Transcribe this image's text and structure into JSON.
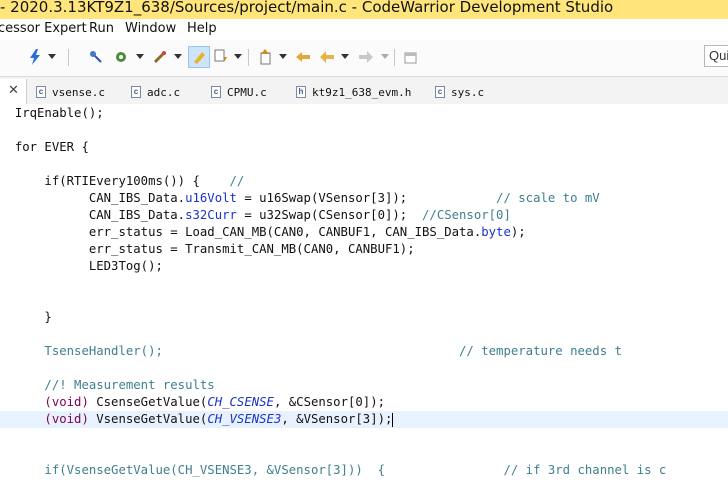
{
  "window": {
    "title": "- 2020.3.13KT9Z1_638/Sources/project/main.c - CodeWarrior Development Studio"
  },
  "menu": {
    "items": [
      "cessor Expert",
      "Run",
      "Window",
      "Help"
    ]
  },
  "toolbar": {
    "icons": [
      "lightning-icon",
      "bug-pin-icon",
      "gear-bug-icon",
      "wand-icon",
      "highlight-icon",
      "annotation-down-icon",
      "annotation-up-icon",
      "back-icon",
      "forward-icon",
      "new-window-icon"
    ],
    "search_placeholder": "Quic"
  },
  "tabs": [
    {
      "label": "vsense.c",
      "icon": "c"
    },
    {
      "label": "adc.c",
      "icon": "c"
    },
    {
      "label": "CPMU.c",
      "icon": "c"
    },
    {
      "label": "kt9z1_638_evm.h",
      "icon": "h"
    },
    {
      "label": "sys.c",
      "icon": "c"
    }
  ],
  "code": {
    "l1": "IrqEnable();",
    "l2": "for EVER {",
    "l3a": "if(RTIEvery100ms()) {",
    "l3b": "//",
    "l4a": "CAN_IBS_Data.",
    "l4b": "u16Volt",
    "l4c": " = u16Swap(VSensor[3]);",
    "l4d": "// scale to mV",
    "l5a": "CAN_IBS_Data.",
    "l5b": "s32Curr",
    "l5c": " = u32Swap(CSensor[0]);",
    "l5d": "//CSensor[0]",
    "l6a": "err_status = Load_CAN_MB(CAN0, CANBUF1, CAN_IBS_Data.",
    "l6b": "byte",
    "l6c": ");",
    "l7": "err_status = Transmit_CAN_MB(CAN0, CANBUF1);",
    "l8": "LED3Tog();",
    "l9": "}",
    "l10a": "TsenseHandler();",
    "l10b": "// temperature needs t",
    "l11": "//! Measurement results",
    "l12a": "(void)",
    "l12b": " CsenseGetValue(",
    "l12c": "CH_CSENSE",
    "l12d": ", &CSensor[0]);",
    "l13a": "(void)",
    "l13b": " VsenseGetValue(",
    "l13c": "CH_VSENSE3",
    "l13d": ", &VSensor[3]);",
    "l14a": "if(VsenseGetValue(CH_VSENSE3, &VSensor[3]))  {",
    "l14b": "// if 3rd channel is c"
  },
  "colors": {
    "title_bar": "#ffe57a",
    "current_line": "#e8f2fe",
    "comment": "#3f7f8f",
    "field": "#1a33c8"
  }
}
